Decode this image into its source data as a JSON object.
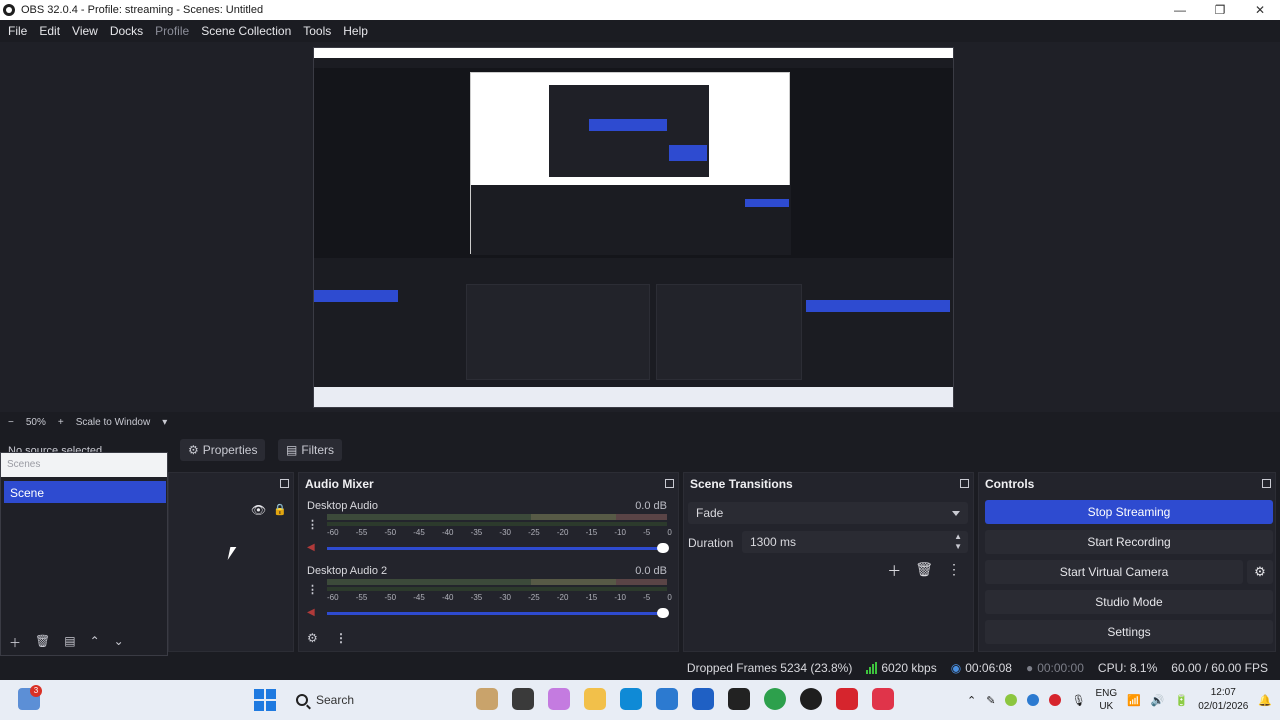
{
  "window": {
    "title": "OBS 32.0.4 - Profile: streaming - Scenes: Untitled",
    "controls": [
      "—",
      "❐",
      "✕"
    ]
  },
  "menu": [
    "File",
    "Edit",
    "View",
    "Docks",
    "Profile",
    "Scene Collection",
    "Tools",
    "Help"
  ],
  "zoom": {
    "minus": "−",
    "percent": "50%",
    "plus": "+",
    "scale_label": "Scale to Window"
  },
  "sources_bar": {
    "no_source": "No source selected",
    "properties": "Properties",
    "filters": "Filters"
  },
  "scenes": {
    "header": "Scenes",
    "items": [
      "Scene"
    ]
  },
  "mixer": {
    "title": "Audio Mixer",
    "channels": [
      {
        "name": "Desktop Audio",
        "db": "0.0 dB"
      },
      {
        "name": "Desktop Audio 2",
        "db": "0.0 dB"
      }
    ],
    "scale": [
      "-60",
      "-55",
      "-50",
      "-45",
      "-40",
      "-35",
      "-30",
      "-25",
      "-20",
      "-15",
      "-10",
      "-5",
      "0"
    ]
  },
  "transitions": {
    "title": "Scene Transitions",
    "selected": "Fade",
    "duration_label": "Duration",
    "duration_value": "1300 ms"
  },
  "controls": {
    "title": "Controls",
    "stop_streaming": "Stop Streaming",
    "start_recording": "Start Recording",
    "start_virtual_camera": "Start Virtual Camera",
    "studio_mode": "Studio Mode",
    "settings": "Settings"
  },
  "status": {
    "dropped": "Dropped Frames 5234 (23.8%)",
    "bitrate": "6020 kbps",
    "stream_time": "00:06:08",
    "rec_time": "00:00:00",
    "cpu": "CPU: 8.1%",
    "fps": "60.00 / 60.00 FPS"
  },
  "taskbar": {
    "badge": "3",
    "search": "Search",
    "lang_1": "ENG",
    "lang_2": "UK",
    "time": "12:07",
    "date": "02/01/2026"
  },
  "colors": {
    "accent": "#2e4bd0",
    "background": "#1b1c22",
    "panel": "#23242c"
  }
}
